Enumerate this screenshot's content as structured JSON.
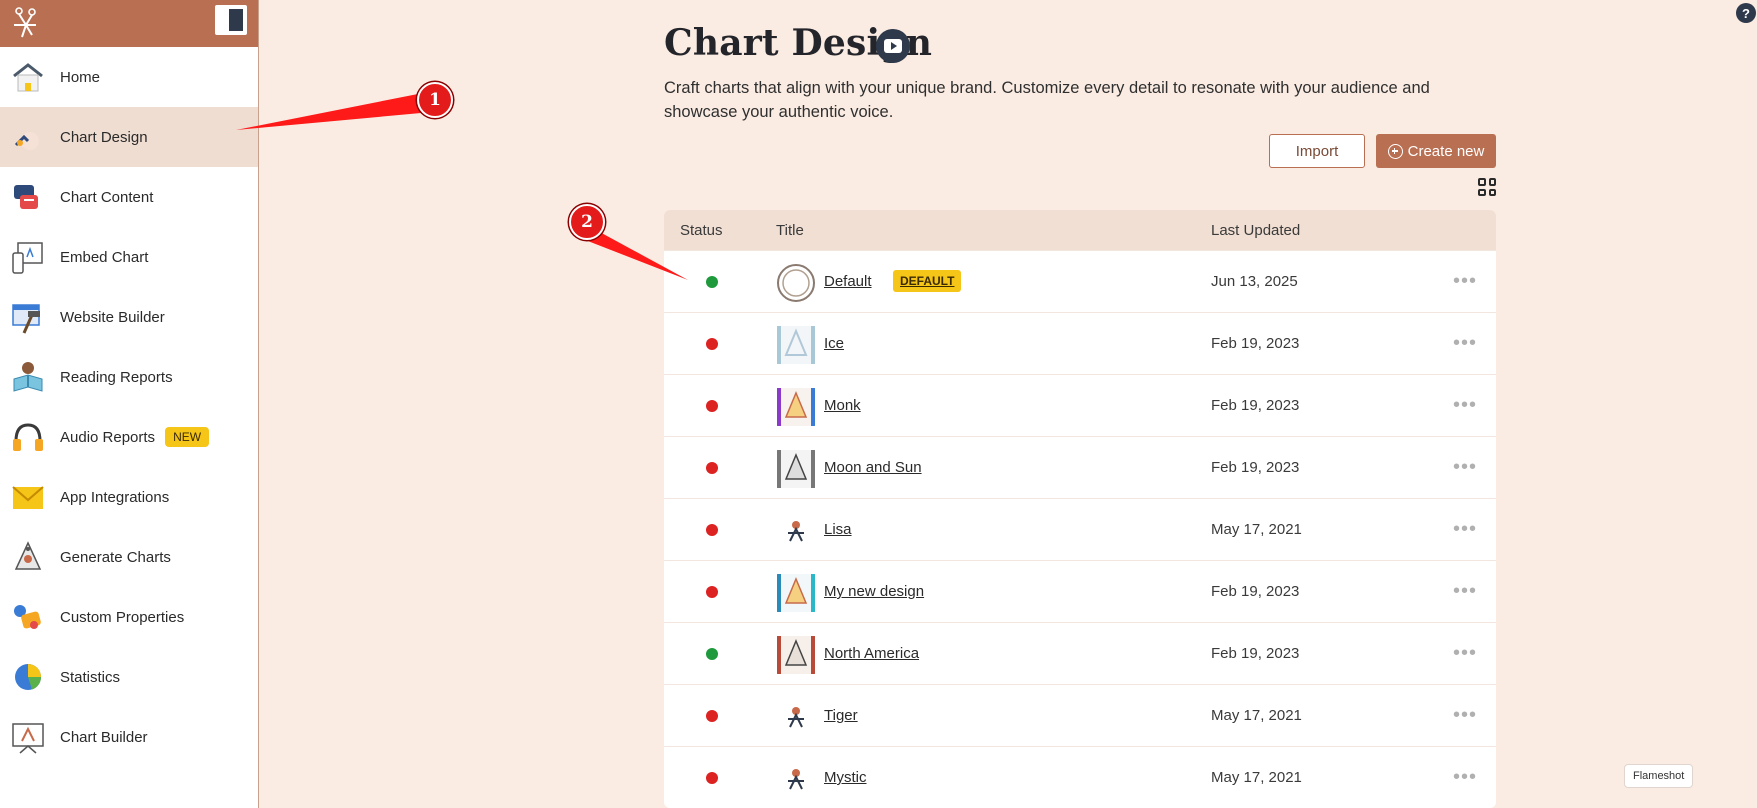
{
  "sidebar": {
    "items": [
      {
        "label": "Home",
        "icon": "home-icon"
      },
      {
        "label": "Chart Design",
        "icon": "chart-design-icon",
        "active": true
      },
      {
        "label": "Chart Content",
        "icon": "chart-content-icon"
      },
      {
        "label": "Embed Chart",
        "icon": "embed-chart-icon"
      },
      {
        "label": "Website Builder",
        "icon": "website-builder-icon"
      },
      {
        "label": "Reading Reports",
        "icon": "reading-reports-icon"
      },
      {
        "label": "Audio Reports",
        "icon": "headphones-icon",
        "badge": "NEW"
      },
      {
        "label": "App Integrations",
        "icon": "envelope-icon"
      },
      {
        "label": "Generate Charts",
        "icon": "generate-charts-icon"
      },
      {
        "label": "Custom Properties",
        "icon": "custom-properties-icon"
      },
      {
        "label": "Statistics",
        "icon": "pie-chart-icon"
      },
      {
        "label": "Chart Builder",
        "icon": "chart-builder-icon"
      }
    ]
  },
  "main": {
    "title": "Chart Design",
    "description": "Craft charts that align with your unique brand. Customize every detail to resonate with your audience and showcase your authentic voice.",
    "import_label": "Import",
    "create_label": "Create new"
  },
  "table": {
    "headers": {
      "status": "Status",
      "title": "Title",
      "updated": "Last Updated"
    },
    "rows": [
      {
        "status": "active",
        "title": "Default",
        "badge": "DEFAULT",
        "date": "Jun 13, 2025"
      },
      {
        "status": "inactive",
        "title": "Ice",
        "date": "Feb 19, 2023"
      },
      {
        "status": "inactive",
        "title": "Monk",
        "date": "Feb 19, 2023"
      },
      {
        "status": "inactive",
        "title": "Moon and Sun",
        "date": "Feb 19, 2023"
      },
      {
        "status": "inactive",
        "title": "Lisa",
        "date": "May 17, 2021"
      },
      {
        "status": "inactive",
        "title": "My new design",
        "date": "Feb 19, 2023"
      },
      {
        "status": "active",
        "title": "North America",
        "date": "Feb 19, 2023"
      },
      {
        "status": "inactive",
        "title": "Tiger",
        "date": "May 17, 2021"
      },
      {
        "status": "inactive",
        "title": "Mystic",
        "date": "May 17, 2021"
      }
    ],
    "more_glyph": "•••"
  },
  "annotations": {
    "marker_1": "1",
    "marker_2": "2"
  },
  "misc": {
    "help": "?",
    "flameshot": "Flameshot"
  },
  "colors": {
    "brand": "#b86f52",
    "active_dot": "#1e9a3c",
    "inactive_dot": "#dd2222",
    "badge": "#f5c518",
    "annotation": "#e31b1b"
  }
}
